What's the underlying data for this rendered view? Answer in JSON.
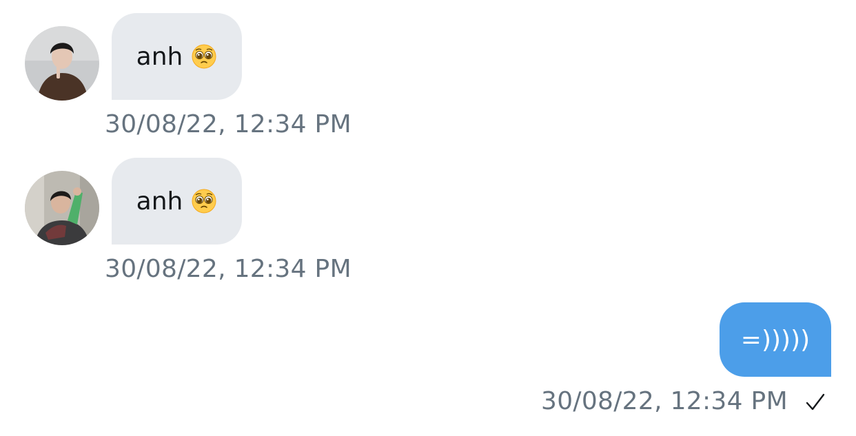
{
  "messages": [
    {
      "direction": "incoming",
      "avatar_icon": "avatar-photo-icon",
      "text": "anh",
      "emoji": "pleading-face-emoji",
      "timestamp": "30/08/22, 12:34 PM"
    },
    {
      "direction": "incoming",
      "avatar_icon": "avatar-photo-icon",
      "text": "anh",
      "emoji": "pleading-face-emoji",
      "timestamp": "30/08/22, 12:34 PM"
    },
    {
      "direction": "outgoing",
      "text": "=)))))",
      "timestamp": "30/08/22, 12:34 PM",
      "status_icon": "checkmark-icon"
    }
  ],
  "colors": {
    "incoming_bubble": "#e7eaee",
    "outgoing_bubble": "#4c9ee9",
    "timestamp": "#66737f"
  }
}
